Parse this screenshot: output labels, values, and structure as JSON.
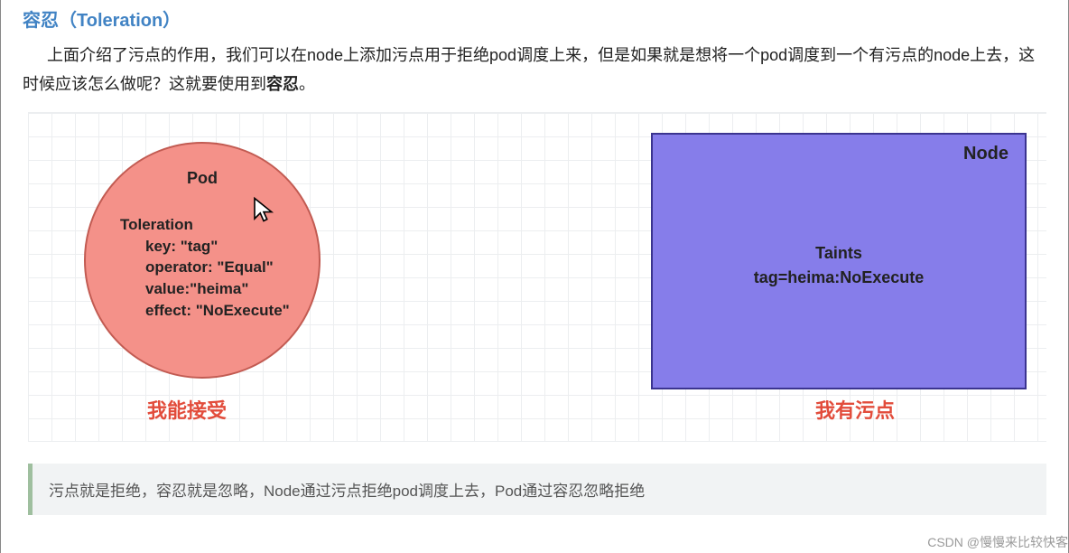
{
  "heading": "容忍（Toleration）",
  "intro_part1": "上面介绍了污点的作用，我们可以在node上添加污点用于拒绝pod调度上来，但是如果就是想将一个pod调度到一个有污点的node上去，这时候应该怎么做呢？这就要使用到",
  "intro_bold": "容忍",
  "intro_part2": "。",
  "pod": {
    "title": "Pod",
    "section": "Toleration",
    "kv1": "key: \"tag\"",
    "kv2": "operator: \"Equal\"",
    "kv3": "value:\"heima\"",
    "kv4": "effect: \"NoExecute\""
  },
  "node": {
    "title": "Node",
    "section": "Taints",
    "line": "tag=heima:NoExecute"
  },
  "caption_left": "我能接受",
  "caption_right": "我有污点",
  "quote": "污点就是拒绝，容忍就是忽略，Node通过污点拒绝pod调度上去，Pod通过容忍忽略拒绝",
  "watermark": "CSDN @慢慢来比较快客"
}
